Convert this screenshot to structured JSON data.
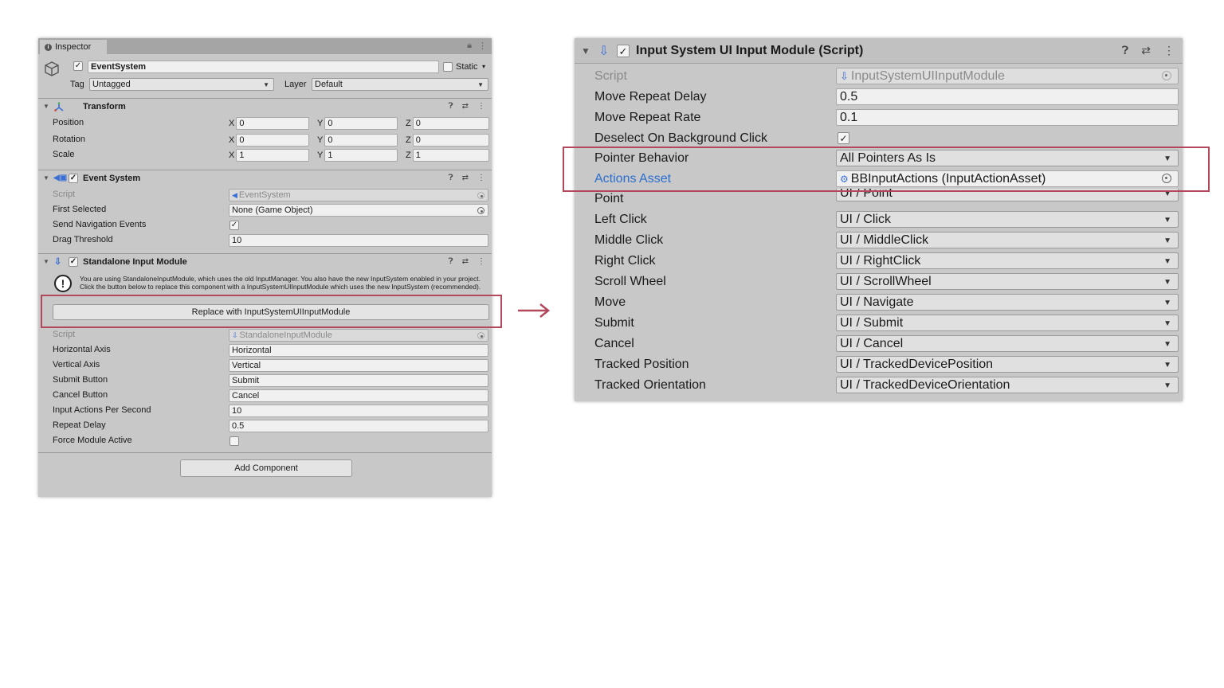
{
  "inspector": {
    "tab_label": "Inspector",
    "gameobject": {
      "name": "EventSystem",
      "static_label": "Static",
      "tag_label": "Tag",
      "tag_value": "Untagged",
      "layer_label": "Layer",
      "layer_value": "Default"
    },
    "transform": {
      "title": "Transform",
      "rows": [
        {
          "label": "Position",
          "x": "0",
          "y": "0",
          "z": "0"
        },
        {
          "label": "Rotation",
          "x": "0",
          "y": "0",
          "z": "0"
        },
        {
          "label": "Scale",
          "x": "1",
          "y": "1",
          "z": "1"
        }
      ],
      "axis_x": "X",
      "axis_y": "Y",
      "axis_z": "Z"
    },
    "event_system": {
      "title": "Event System",
      "script_label": "Script",
      "script_value": "EventSystem",
      "first_selected_label": "First Selected",
      "first_selected_value": "None (Game Object)",
      "send_nav_label": "Send Navigation Events",
      "send_nav_checked": "✓",
      "drag_label": "Drag Threshold",
      "drag_value": "10"
    },
    "standalone": {
      "title": "Standalone Input Module",
      "help_text": "You are using StandaloneInputModule, which uses the old InputManager. You also have the new InputSystem enabled in your project. Click the button below to replace this component with a InputSystemUIInputModule which uses the new InputSystem (recommended).",
      "replace_button": "Replace with InputSystemUIInputModule",
      "script_label": "Script",
      "script_value": "StandaloneInputModule",
      "rows": [
        {
          "label": "Horizontal Axis",
          "value": "Horizontal"
        },
        {
          "label": "Vertical Axis",
          "value": "Vertical"
        },
        {
          "label": "Submit Button",
          "value": "Submit"
        },
        {
          "label": "Cancel Button",
          "value": "Cancel"
        },
        {
          "label": "Input Actions Per Second",
          "value": "10"
        },
        {
          "label": "Repeat Delay",
          "value": "0.5"
        }
      ],
      "force_label": "Force Module Active"
    },
    "add_component": "Add Component"
  },
  "module": {
    "title": "Input System UI Input Module (Script)",
    "check": "✓",
    "script_label": "Script",
    "script_value": "InputSystemUIInputModule",
    "move_delay_label": "Move Repeat Delay",
    "move_delay_value": "0.5",
    "move_rate_label": "Move Repeat Rate",
    "move_rate_value": "0.1",
    "deselect_label": "Deselect On Background Click",
    "deselect_checked": "✓",
    "pointer_label": "Pointer Behavior",
    "pointer_value": "All Pointers As Is",
    "actions_label": "Actions Asset",
    "actions_value": "BBInputActions (InputActionAsset)",
    "bindings": [
      {
        "label": "Point",
        "value": "UI / Point"
      },
      {
        "label": "Left Click",
        "value": "UI / Click"
      },
      {
        "label": "Middle Click",
        "value": "UI / MiddleClick"
      },
      {
        "label": "Right Click",
        "value": "UI / RightClick"
      },
      {
        "label": "Scroll Wheel",
        "value": "UI / ScrollWheel"
      },
      {
        "label": "Move",
        "value": "UI / Navigate"
      },
      {
        "label": "Submit",
        "value": "UI / Submit"
      },
      {
        "label": "Cancel",
        "value": "UI / Cancel"
      },
      {
        "label": "Tracked Position",
        "value": "UI / TrackedDevicePosition"
      },
      {
        "label": "Tracked Orientation",
        "value": "UI / TrackedDeviceOrientation"
      }
    ]
  },
  "colors": {
    "highlight": "#b2485c",
    "link": "#2a6ed0",
    "panel_bg": "#c8c8c8"
  },
  "icons": [
    "info-icon",
    "lock-icon",
    "kebab-menu-icon",
    "cube-icon",
    "transform-icon",
    "event-system-icon",
    "input-module-icon",
    "help-icon",
    "preset-icon",
    "warning-icon",
    "target-icon",
    "arrow-right-icon",
    "asset-icon"
  ]
}
